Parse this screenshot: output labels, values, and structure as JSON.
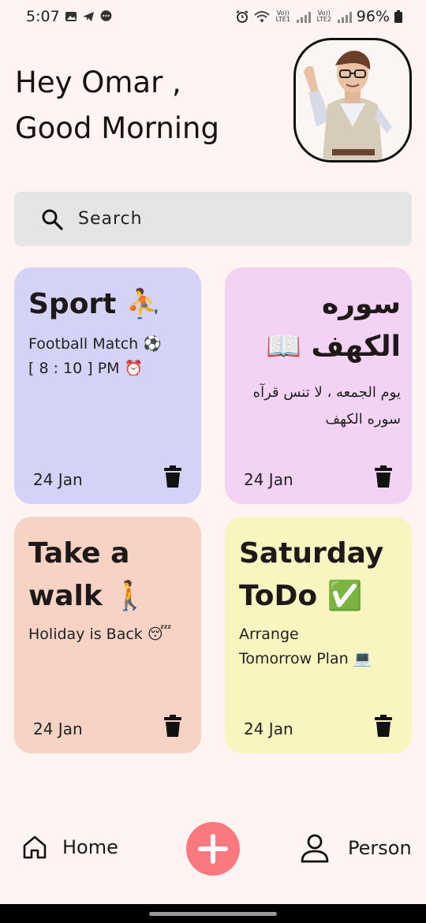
{
  "status_bar": {
    "time": "5:07",
    "sim1_label": "Vo)) LTE1",
    "sim2_label": "Vo)) LTE2",
    "battery": "96%"
  },
  "greeting": {
    "line1": "Hey Omar ,",
    "line2": "Good Morning"
  },
  "search": {
    "placeholder": "Search"
  },
  "notes": [
    {
      "title": "Sport ⛹",
      "body_lines": [
        "Football Match ⚽",
        "[ 8 : 10 ] PM ⏰"
      ],
      "date": "24 Jan",
      "color": "#d4d2f6"
    },
    {
      "title": "سوره الكهف 📖",
      "body_lines": [
        "يوم الجمعه ، لا تنس قرآه",
        "سوره الكهف"
      ],
      "date": "24 Jan",
      "color": "#f2d3f4"
    },
    {
      "title": "Take a walk 🚶",
      "body_lines": [
        "Holiday is Back 😴"
      ],
      "date": "24 Jan",
      "color": "#f6d3c5"
    },
    {
      "title": "Saturday ToDo ✅",
      "body_lines": [
        "Arrange",
        "Tomorrow Plan 💻"
      ],
      "date": "24 Jan",
      "color": "#f9f5c1"
    }
  ],
  "bottom_nav": {
    "home_label": "Home",
    "person_label": "Person",
    "add_color": "#f9797f"
  }
}
